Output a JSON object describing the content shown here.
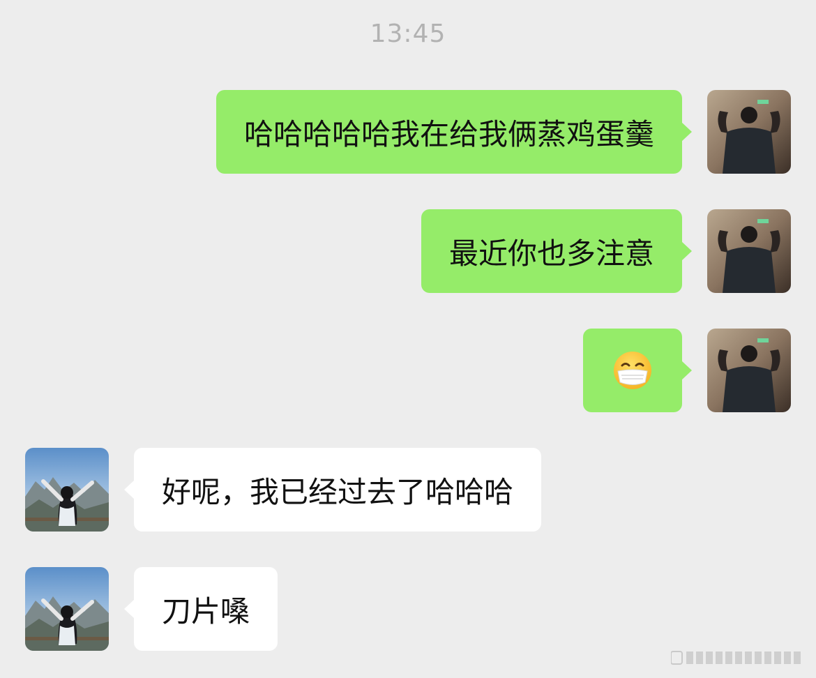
{
  "timestamp": "13:45",
  "messages": [
    {
      "side": "me",
      "text": "哈哈哈哈哈我在给我俩蒸鸡蛋羹"
    },
    {
      "side": "me",
      "text": "最近你也多注意"
    },
    {
      "side": "me",
      "emoji": "face-with-medical-mask-emoji"
    },
    {
      "side": "them",
      "text": "好呢，我已经过去了哈哈哈"
    },
    {
      "side": "them",
      "text": "刀片嗓"
    }
  ],
  "colors": {
    "background": "#ededed",
    "bubble_me": "#95ec69",
    "bubble_them": "#ffffff",
    "timestamp": "#b2b2b2"
  }
}
